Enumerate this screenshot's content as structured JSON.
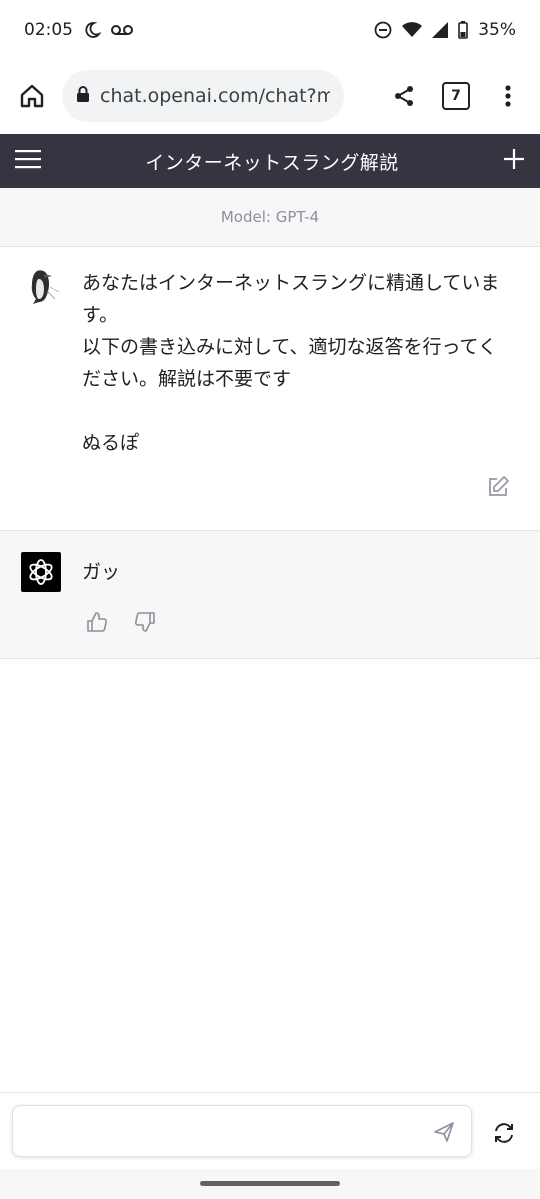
{
  "status_bar": {
    "time": "02:05",
    "battery": "35%"
  },
  "browser": {
    "url": "chat.openai.com/chat?m",
    "tab_count": "7"
  },
  "app_bar": {
    "title": "インターネットスラング解説"
  },
  "model_info": "Model: GPT-4",
  "conversation": {
    "user_message": "あなたはインターネットスラングに精通しています。\n以下の書き込みに対して、適切な返答を行ってください。解説は不要です\n\nぬるぽ",
    "assistant_message": "ガッ"
  },
  "composer": {
    "placeholder": ""
  },
  "colors": {
    "app_bar_bg": "#343541",
    "assistant_bg": "#f7f7f8",
    "model_text": "#8e8ea0"
  }
}
